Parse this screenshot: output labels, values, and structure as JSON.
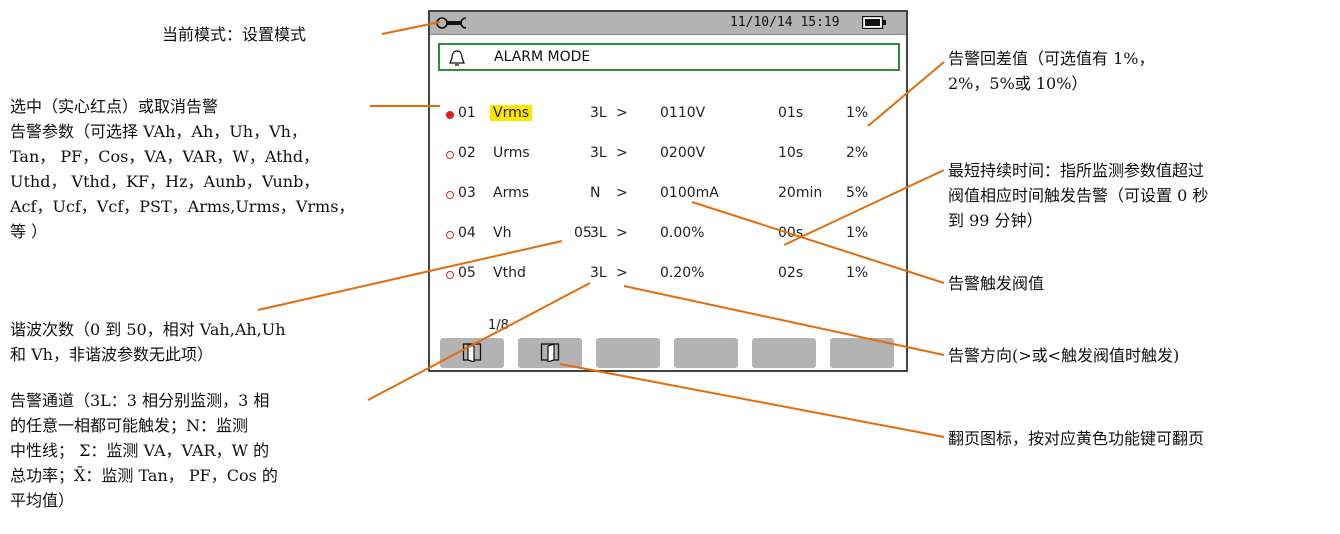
{
  "screen": {
    "status": {
      "datetime": "11/10/14  15:19"
    },
    "title": "ALARM MODE",
    "rows": [
      {
        "num": "01",
        "param": "Vrms",
        "order": "",
        "channel": "3L",
        "dir": ">",
        "threshold": "0110V",
        "duration": "01s",
        "hysteresis": "1%",
        "enabled": true
      },
      {
        "num": "02",
        "param": "Urms",
        "order": "",
        "channel": "3L",
        "dir": ">",
        "threshold": "0200V",
        "duration": "10s",
        "hysteresis": "2%",
        "enabled": false
      },
      {
        "num": "03",
        "param": "Arms",
        "order": "",
        "channel": "N",
        "dir": ">",
        "threshold": "0100mA",
        "duration": "20min",
        "hysteresis": "5%",
        "enabled": false
      },
      {
        "num": "04",
        "param": "Vh",
        "order": "05",
        "channel": "3L",
        "dir": ">",
        "threshold": "0.00%",
        "duration": "00s",
        "hysteresis": "1%",
        "enabled": false
      },
      {
        "num": "05",
        "param": "Vthd",
        "order": "",
        "channel": "3L",
        "dir": ">",
        "threshold": "0.20%",
        "duration": "02s",
        "hysteresis": "1%",
        "enabled": false
      }
    ],
    "page_indicator": "1/8",
    "accent_color": "#2e8b3e",
    "selected_color": "#ffe600",
    "alarm_dot_color": "#e02020"
  },
  "annotations": {
    "current_mode": "当前模式：设置模式",
    "select_alarm": "选中（实心红点）或取消告警",
    "alarm_params": [
      "告警参数（可选择 VAh，Ah，Uh，Vh，",
      "Tan，  PF，Cos，VA，VAR，W，Athd，",
      "Uthd，  Vthd，KF，Hz，Aunb，Vunb，",
      "Acf，Ucf，Vcf，PST，Arms,Urms，Vrms，",
      "等  ）"
    ],
    "harmonic_order": [
      "谐波次数（0 到 50，相对 Vah,Ah,Uh",
      "和 Vh，非谐波参数无此项）"
    ],
    "alarm_channel": [
      "告警通道（3L：3 相分别监测，3 相",
      "的任意一相都可能触发；N：监测",
      "中性线；  Σ：监测 VA，VAR，W 的",
      "总功率；X̄：监测 Tan，  PF，Cos 的",
      "平均值）"
    ],
    "hysteresis": [
      "告警回差值（可选值有 1%，",
      "2%，5%或 10%）"
    ],
    "min_duration": [
      "最短持续时间：指所监测参数值超过",
      "阀值相应时间触发告警（可设置 0 秒",
      "到 99 分钟）"
    ],
    "threshold": "告警触发阀值",
    "direction": "告警方向(>或<触发阀值时触发)",
    "page_icon": "翻页图标，按对应黄色功能键可翻页"
  }
}
